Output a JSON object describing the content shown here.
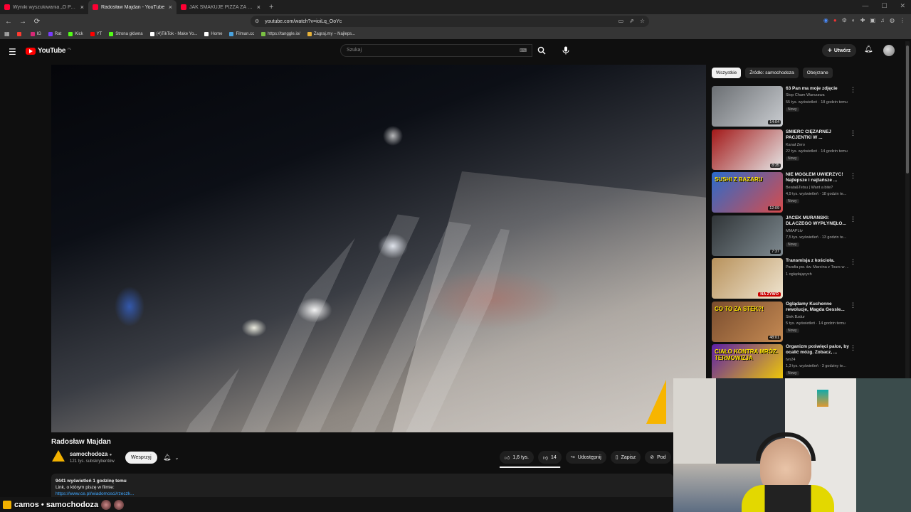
{
  "browser": {
    "tabs": [
      {
        "title": "Wyniki wyszukiwania „O PANI” w ser",
        "active": false
      },
      {
        "title": "Radosław Majdan - YouTube",
        "active": true
      },
      {
        "title": "JAK SMAKUJE PIZZA ZA 3,50zł? - Yo",
        "active": false
      }
    ],
    "new_tab": "+",
    "url": "youtube.com/watch?v=ioiLq_OoYc",
    "bookmarks": [
      {
        "label": "",
        "color": "#ff3b30"
      },
      {
        "label": "IG",
        "color": "#d62976"
      },
      {
        "label": "Rat",
        "color": "#7a3cff"
      },
      {
        "label": "Kick",
        "color": "#53fc18"
      },
      {
        "label": "YT",
        "color": "#ff0000"
      },
      {
        "label": "Strona główna",
        "color": "#53fc18"
      },
      {
        "label": "(4)TikTok - Make Yo...",
        "color": "#ffffff"
      },
      {
        "label": "Home",
        "color": "#ffffff"
      },
      {
        "label": "Filman.cc",
        "color": "#4aa3df"
      },
      {
        "label": "https://tanggle.io/",
        "color": "#7ac143"
      },
      {
        "label": "Zagraj.my – Najleps...",
        "color": "#e8b339"
      }
    ]
  },
  "youtube": {
    "logo_text": "YouTube",
    "country_code": "PL",
    "search_placeholder": "Szukaj",
    "create_label": "Utwórz"
  },
  "video": {
    "title": "Radosław Majdan",
    "channel": "samochodoza",
    "subscribers": "121 tys. subskrybentów",
    "support_label": "Wesprzyj",
    "likes": "1,6 tys.",
    "dislikes": "14",
    "share_label": "Udostępnij",
    "save_label": "Zapisz",
    "more_label": "Pod",
    "like_ratio": 0.99,
    "description_meta": "9441 wyświetleń  1 godzinę temu",
    "description_line": "Link, o którym piszę w filmie:",
    "description_link": "https://www.ce.pl/wiadomosci/rzeczk..."
  },
  "sidebar": {
    "chips": [
      "Wszystkie",
      "Źródło: samochodoza",
      "Obejrzane"
    ],
    "items": [
      {
        "title": "63 Pan ma moje zdjęcie",
        "channel": "Stop Cham Warszawa",
        "views": "55 tys. wyświetleń · 18 godzin temu",
        "badge": "Nowy",
        "duration": "14:04",
        "thumb_text": "",
        "color1": "#6b6f73",
        "color2": "#c9ccd0"
      },
      {
        "title": "ŚMIERĆ CIĘŻARNEJ PACJENTKI W ...",
        "channel": "Kanał Zero",
        "views": "22 tys. wyświetleń · 14 godzin temu",
        "badge": "Nowy",
        "duration": "8:35",
        "thumb_text": "",
        "color1": "#a31919",
        "color2": "#e5e5e5"
      },
      {
        "title": "NIE MOGŁEM UWIERZYĆ! Najlepsze i najtańsze ...",
        "channel": "Beata&Tetsu | Want a bite?",
        "views": "4,9 tys. wyświetleń · 18 godzin te...",
        "badge": "Nowy",
        "duration": "12:09",
        "thumb_text": "SUSHI Z BAZARU",
        "color1": "#2a6bcc",
        "color2": "#d74c4c"
      },
      {
        "title": "JACEK MURAŃSKI: DLACZEGO WYPŁYNĘŁO...",
        "channel": "MMAPLtv",
        "views": "7,5 tys. wyświetleń · 13 godzin te...",
        "badge": "Nowy",
        "duration": "7:37",
        "thumb_text": "",
        "color1": "#303538",
        "color2": "#7f8a90"
      },
      {
        "title": "Transmisja z kościoła.",
        "channel": "Parafia pw. św. Marcina z Tours w ...",
        "views": "1 oglądających",
        "badge": "",
        "duration": "",
        "live": "NA ŻYWO",
        "thumb_text": "",
        "color1": "#b8925c",
        "color2": "#efe4cf"
      },
      {
        "title": "Oglądamy Kuchenne rewolucje, Magda Gessle...",
        "channel": "Stek Bzdur",
        "views": "5 tys. wyświetleń · 14 godzin temu",
        "badge": "Nowy",
        "duration": "48:01",
        "thumb_text": "CO TO ZA STEK?!",
        "color1": "#7a4d2e",
        "color2": "#c58a53"
      },
      {
        "title": "Organizm poświęci palce, by ocalić mózg. Zobacz, ...",
        "channel": "tvn24",
        "views": "1,3 tys. wyświetleń · 3 godziny te...",
        "badge": "Nowy",
        "duration": "11:33",
        "thumb_text": "CIAŁO KONTRA MRÓZ. TERMOWIZJA",
        "color1": "#5d1fa8",
        "color2": "#f5d000"
      }
    ]
  },
  "stream_overlay": {
    "text": "camos • samochodoza"
  }
}
